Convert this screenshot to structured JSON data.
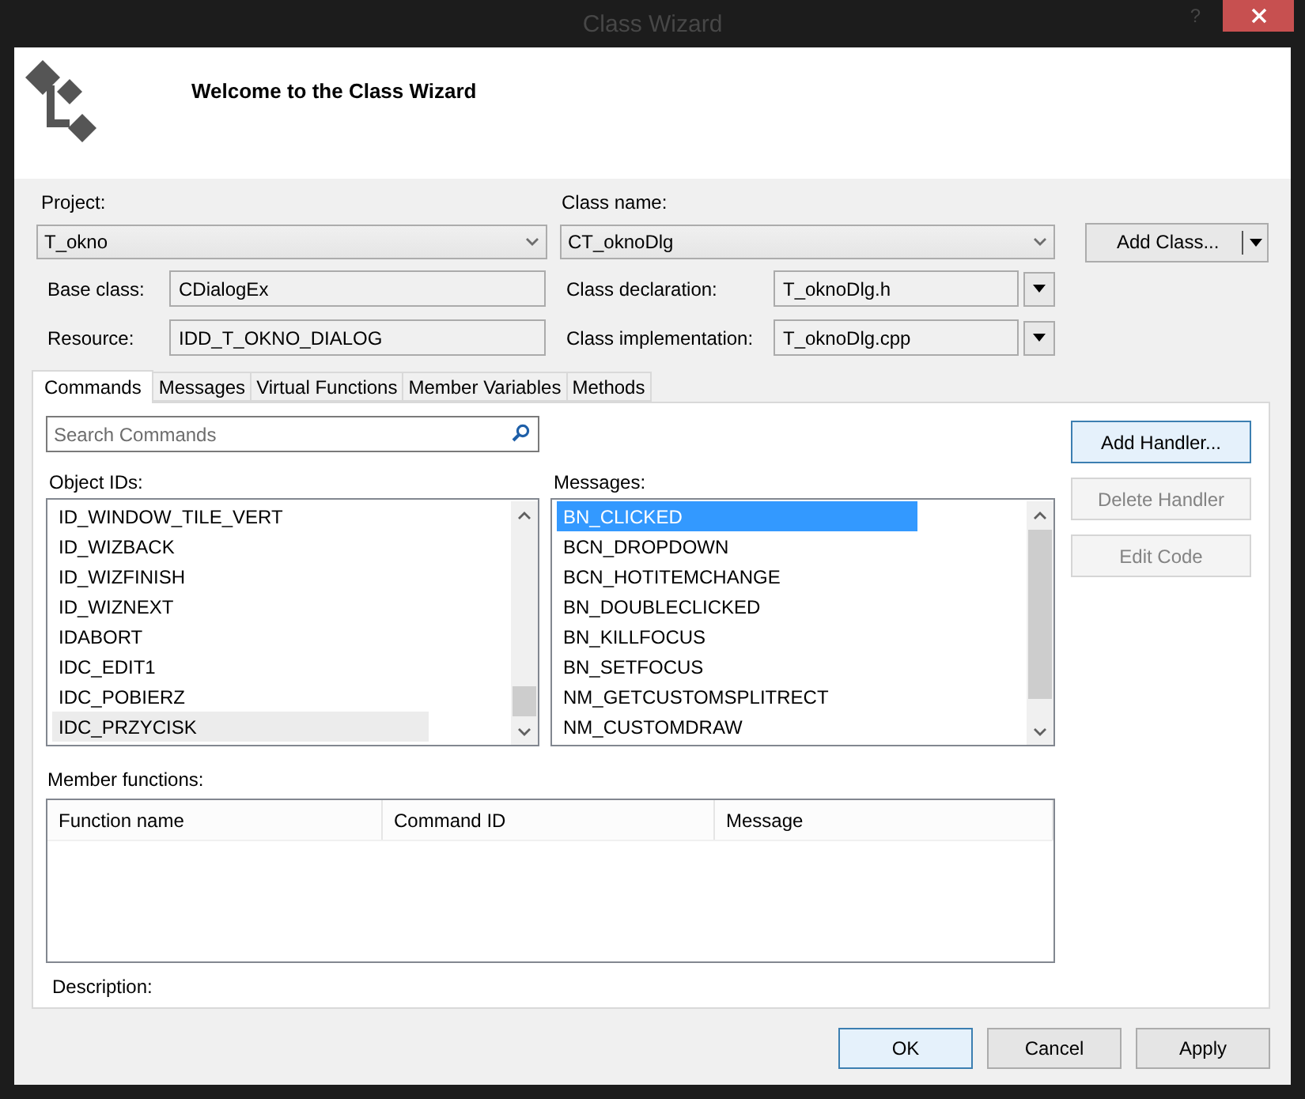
{
  "window": {
    "title": "Class Wizard",
    "help": "?"
  },
  "header": {
    "title": "Welcome to the Class Wizard"
  },
  "project": {
    "label": "Project:",
    "value": "T_okno"
  },
  "class_name": {
    "label": "Class name:",
    "value": "CT_oknoDlg"
  },
  "add_class_button": {
    "label": "Add Class..."
  },
  "base_class": {
    "label": "Base class:",
    "value": "CDialogEx"
  },
  "class_declaration": {
    "label": "Class declaration:",
    "value": "T_oknoDlg.h"
  },
  "resource": {
    "label": "Resource:",
    "value": "IDD_T_OKNO_DIALOG"
  },
  "class_implementation": {
    "label": "Class implementation:",
    "value": "T_oknoDlg.cpp"
  },
  "tabs": [
    {
      "label": "Commands",
      "selected": true
    },
    {
      "label": "Messages",
      "selected": false
    },
    {
      "label": "Virtual Functions",
      "selected": false
    },
    {
      "label": "Member Variables",
      "selected": false
    },
    {
      "label": "Methods",
      "selected": false
    }
  ],
  "search": {
    "placeholder": "Search Commands"
  },
  "object_ids": {
    "label": "Object IDs:",
    "focused": false,
    "items": [
      {
        "text": "ID_WINDOW_TILE_VERT",
        "selected": false
      },
      {
        "text": "ID_WIZBACK",
        "selected": false
      },
      {
        "text": "ID_WIZFINISH",
        "selected": false
      },
      {
        "text": "ID_WIZNEXT",
        "selected": false
      },
      {
        "text": "IDABORT",
        "selected": false
      },
      {
        "text": "IDC_EDIT1",
        "selected": false
      },
      {
        "text": "IDC_POBIERZ",
        "selected": false
      },
      {
        "text": "IDC_PRZYCISK",
        "selected": true
      }
    ]
  },
  "messages": {
    "label": "Messages:",
    "focused": true,
    "items": [
      {
        "text": "BN_CLICKED",
        "selected": true
      },
      {
        "text": "BCN_DROPDOWN",
        "selected": false
      },
      {
        "text": "BCN_HOTITEMCHANGE",
        "selected": false
      },
      {
        "text": "BN_DOUBLECLICKED",
        "selected": false
      },
      {
        "text": "BN_KILLFOCUS",
        "selected": false
      },
      {
        "text": "BN_SETFOCUS",
        "selected": false
      },
      {
        "text": "NM_GETCUSTOMSPLITRECT",
        "selected": false
      },
      {
        "text": "NM_CUSTOMDRAW",
        "selected": false
      }
    ]
  },
  "actions": [
    {
      "label": "Add Handler...",
      "disabled": false,
      "default": true
    },
    {
      "label": "Delete Handler",
      "disabled": true,
      "default": false
    },
    {
      "label": "Edit Code",
      "disabled": true,
      "default": false
    }
  ],
  "member_functions": {
    "label": "Member functions:",
    "columns": [
      "Function name",
      "Command ID",
      "Message"
    ]
  },
  "description": {
    "label": "Description:"
  },
  "buttons": [
    {
      "label": "OK",
      "default": true
    },
    {
      "label": "Cancel",
      "default": false
    },
    {
      "label": "Apply",
      "default": false
    }
  ]
}
